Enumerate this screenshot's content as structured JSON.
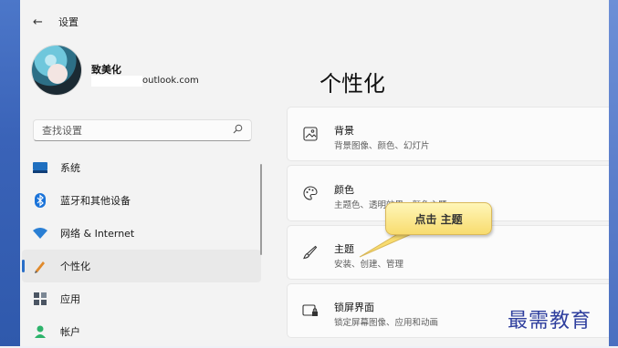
{
  "window": {
    "title": "设置",
    "back_icon": "arrow-left-icon"
  },
  "user": {
    "name": "致美化",
    "email": "outlook.com"
  },
  "search": {
    "placeholder": "查找设置",
    "icon": "search-icon"
  },
  "sidebar": {
    "items": [
      {
        "label": "系统",
        "icon": "monitor-icon",
        "active": false
      },
      {
        "label": "蓝牙和其他设备",
        "icon": "bluetooth-icon",
        "active": false
      },
      {
        "label": "网络 & Internet",
        "icon": "wifi-icon",
        "active": false
      },
      {
        "label": "个性化",
        "icon": "pen-icon",
        "active": true
      },
      {
        "label": "应用",
        "icon": "apps-icon",
        "active": false
      },
      {
        "label": "帐户",
        "icon": "person-icon",
        "active": false
      }
    ]
  },
  "main": {
    "heading": "个性化",
    "cards": [
      {
        "title": "背景",
        "subtitle": "背景图像、颜色、幻灯片",
        "icon": "image-icon"
      },
      {
        "title": "颜色",
        "subtitle": "主题色、透明效果、颜色主题",
        "icon": "palette-icon"
      },
      {
        "title": "主题",
        "subtitle": "安装、创建、管理",
        "icon": "brush-icon"
      },
      {
        "title": "锁屏界面",
        "subtitle": "锁定屏幕图像、应用和动画",
        "icon": "lock-screen-icon"
      }
    ]
  },
  "callout": {
    "text": "点击 主题"
  },
  "watermark": {
    "text": "最需教育"
  },
  "colors": {
    "accent": "#2a6fc8",
    "callout": "#f8dc6f",
    "watermark": "#2f3f9e"
  }
}
